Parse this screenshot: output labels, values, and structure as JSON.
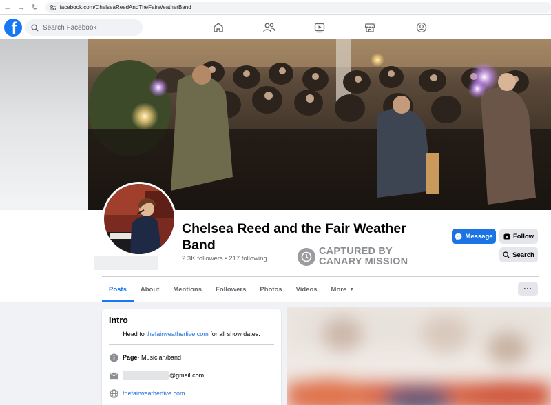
{
  "browser": {
    "url": "facebook.com/ChelseaReedAndTheFairWeatherBand"
  },
  "header": {
    "logo": "f",
    "search_placeholder": "Search Facebook",
    "nav_icons": [
      "home-icon",
      "friends-icon",
      "watch-icon",
      "marketplace-icon",
      "groups-icon"
    ]
  },
  "profile": {
    "name": "Chelsea Reed and the Fair Weather Band",
    "stats": "2.3K followers • 217 following",
    "watermark_line1": "CAPTURED BY",
    "watermark_line2": "CANARY MISSION"
  },
  "actions": {
    "message_label": "Message",
    "follow_label": "Follow",
    "search_label": "Search"
  },
  "tabs": {
    "posts": "Posts",
    "about": "About",
    "mentions": "Mentions",
    "followers": "Followers",
    "photos": "Photos",
    "videos": "Videos",
    "more": "More",
    "overflow": "···"
  },
  "intro": {
    "title": "Intro",
    "bio_prefix": "Head to ",
    "bio_link": "thefairweatherfive.com",
    "bio_suffix": " for all show dates.",
    "page_label": "Page",
    "page_category": " · Musician/band",
    "email_suffix": "@gmail.com",
    "website": "thefairweatherfive.com"
  },
  "colors": {
    "brand": "#1877f2",
    "link": "#216fdb",
    "message_button": "#1b74e4"
  }
}
